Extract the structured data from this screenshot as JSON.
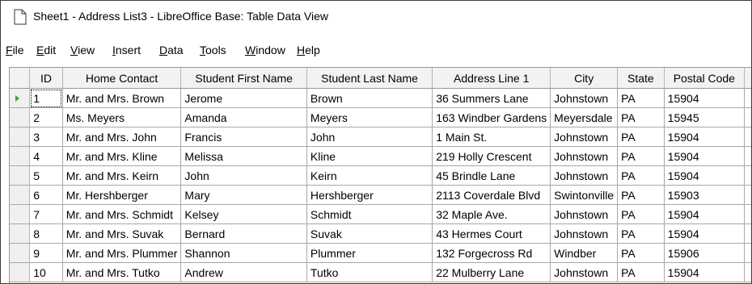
{
  "window": {
    "title": "Sheet1 - Address List3 - LibreOffice Base: Table Data View",
    "icon": "document-icon"
  },
  "menu": {
    "items": [
      {
        "label": "File",
        "accel": "F",
        "rest": "ile"
      },
      {
        "label": "Edit",
        "accel": "E",
        "rest": "dit"
      },
      {
        "label": "View",
        "accel": "V",
        "rest": "iew"
      },
      {
        "label": "Insert",
        "accel": "I",
        "rest": "nsert"
      },
      {
        "label": "Data",
        "accel": "D",
        "rest": "ata"
      },
      {
        "label": "Tools",
        "accel": "T",
        "rest": "ools"
      },
      {
        "label": "Window",
        "accel": "W",
        "rest": "indow"
      },
      {
        "label": "Help",
        "accel": "H",
        "rest": "elp"
      }
    ]
  },
  "table": {
    "columns": [
      "ID",
      "Home Contact",
      "Student First Name",
      "Student Last Name",
      "Address Line 1",
      "City",
      "State",
      "Postal Code"
    ],
    "current_row_index": 0,
    "rows": [
      [
        "1",
        "Mr. and Mrs. Brown",
        "Jerome",
        "Brown",
        "36 Summers Lane",
        "Johnstown",
        "PA",
        "15904"
      ],
      [
        "2",
        "Ms. Meyers",
        "Amanda",
        "Meyers",
        "163 Windber Gardens",
        "Meyersdale",
        "PA",
        "15945"
      ],
      [
        "3",
        "Mr. and Mrs. John",
        "Francis",
        "John",
        "1 Main St.",
        "Johnstown",
        "PA",
        "15904"
      ],
      [
        "4",
        "Mr. and Mrs. Kline",
        "Melissa",
        "Kline",
        "219 Holly Crescent",
        "Johnstown",
        "PA",
        "15904"
      ],
      [
        "5",
        "Mr. and Mrs. Keirn",
        "John",
        "Keirn",
        "45 Brindle Lane",
        "Johnstown",
        "PA",
        "15904"
      ],
      [
        "6",
        "Mr. Hershberger",
        "Mary",
        "Hershberger",
        "2113 Coverdale Blvd",
        "Swintonville",
        "PA",
        "15903"
      ],
      [
        "7",
        "Mr. and Mrs. Schmidt",
        "Kelsey",
        "Schmidt",
        "32 Maple Ave.",
        "Johnstown",
        "PA",
        "15904"
      ],
      [
        "8",
        "Mr. and Mrs. Suvak",
        "Bernard",
        "Suvak",
        "43 Hermes Court",
        "Johnstown",
        "PA",
        "15904"
      ],
      [
        "9",
        "Mr. and Mrs. Plummer",
        "Shannon",
        "Plummer",
        "132 Forgecross Rd",
        "Windber",
        "PA",
        "15906"
      ],
      [
        "10",
        "Mr. and Mrs. Tutko",
        "Andrew",
        "Tutko",
        "22 Mulberry Lane",
        "Johnstown",
        "PA",
        "15904"
      ]
    ]
  }
}
